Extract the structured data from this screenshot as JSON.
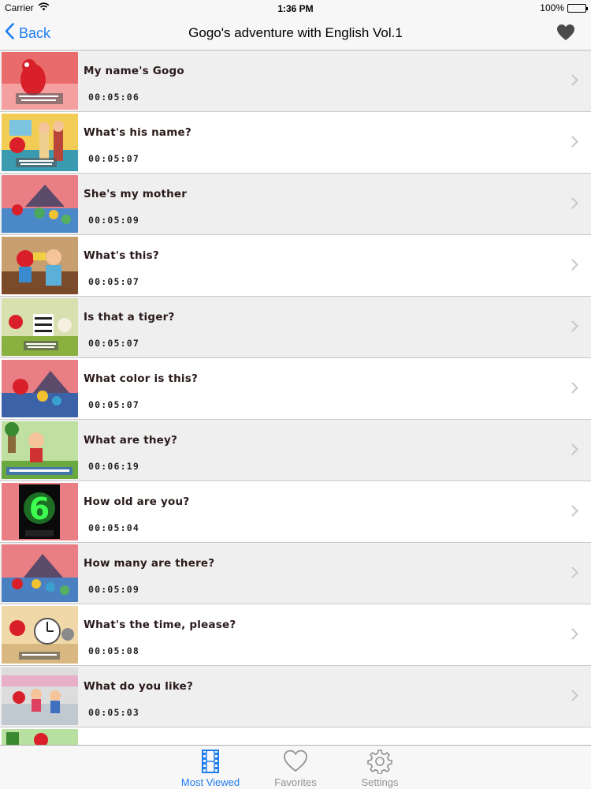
{
  "status_bar": {
    "carrier": "Carrier",
    "time": "1:36 PM",
    "battery": "100%"
  },
  "nav": {
    "back_label": "Back",
    "title": "Gogo's adventure with English Vol.1"
  },
  "episodes": [
    {
      "title": "My name's Gogo",
      "duration": "00:05:06"
    },
    {
      "title": "What's his name?",
      "duration": "00:05:07"
    },
    {
      "title": "She's my mother",
      "duration": "00:05:09"
    },
    {
      "title": "What's this?",
      "duration": "00:05:07"
    },
    {
      "title": "Is that a tiger?",
      "duration": "00:05:07"
    },
    {
      "title": "What color is this?",
      "duration": "00:05:07"
    },
    {
      "title": "What are they?",
      "duration": "00:06:19"
    },
    {
      "title": "How old are you?",
      "duration": "00:05:04"
    },
    {
      "title": "How many are there?",
      "duration": "00:05:09"
    },
    {
      "title": "What's the time, please?",
      "duration": "00:05:08"
    },
    {
      "title": "What do you like?",
      "duration": "00:05:03"
    }
  ],
  "tabs": [
    {
      "label": "Most Viewed",
      "icon": "film-icon",
      "active": true
    },
    {
      "label": "Favorites",
      "icon": "heart-outline-icon",
      "active": false
    },
    {
      "label": "Settings",
      "icon": "gear-icon",
      "active": false
    }
  ],
  "colors": {
    "accent": "#1e7cf0",
    "inactive_tab": "#929292",
    "shaded_row": "#efefef"
  }
}
